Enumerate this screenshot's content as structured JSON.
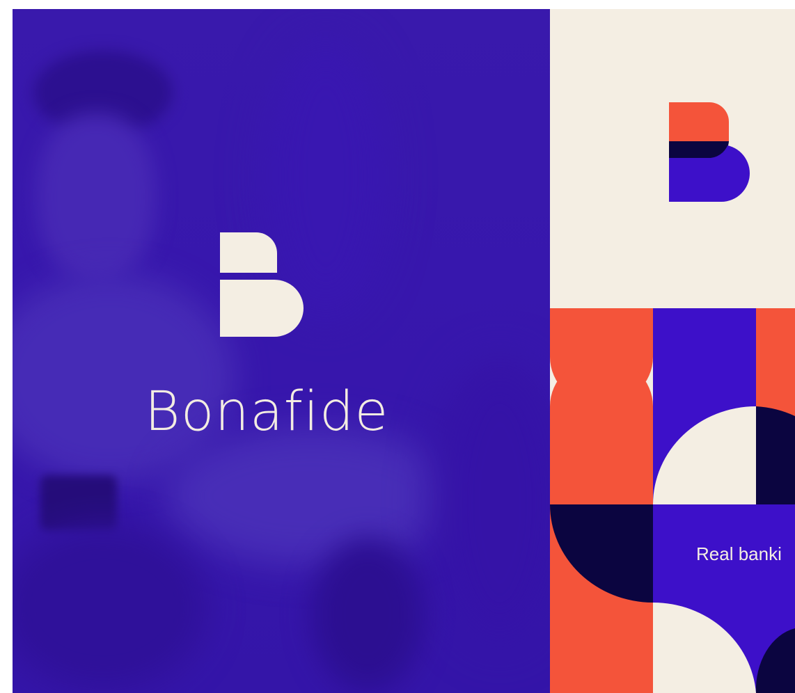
{
  "brand": {
    "name": "Bonafide",
    "tagline": "Real banki"
  },
  "colors": {
    "primary_purple": "#3d10c9",
    "coral": "#f4543a",
    "navy": "#0b0540",
    "cream": "#f4eee3"
  },
  "icons": {
    "left_logo": "bonafide-b-logo-icon",
    "right_logo": "bonafide-b-logo-icon"
  }
}
